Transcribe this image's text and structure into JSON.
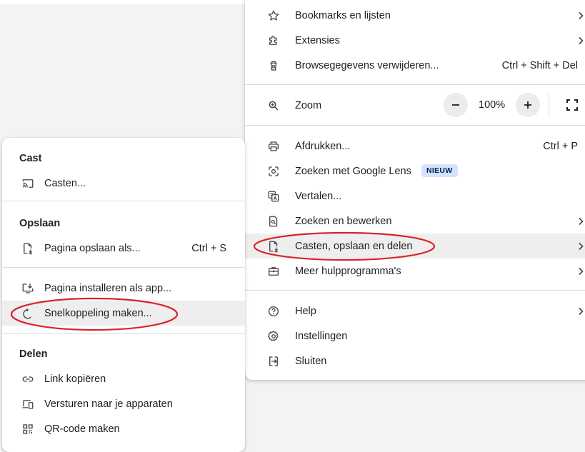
{
  "main_menu": {
    "bookmarks": {
      "label": "Bookmarks en lijsten",
      "icon": "star-icon"
    },
    "extensions": {
      "label": "Extensies",
      "icon": "puzzle-icon"
    },
    "clear_data": {
      "label": "Browsegegevens verwijderen...",
      "shortcut": "Ctrl + Shift + Del",
      "icon": "trash-icon"
    },
    "zoom": {
      "label": "Zoom",
      "value": "100%",
      "minus": "−",
      "plus": "+",
      "icon": "zoom-icon"
    },
    "print": {
      "label": "Afdrukken...",
      "shortcut": "Ctrl + P",
      "icon": "printer-icon"
    },
    "lens": {
      "label": "Zoeken met Google Lens",
      "badge": "NIEUW",
      "icon": "google-lens-icon"
    },
    "translate": {
      "label": "Vertalen...",
      "icon": "translate-icon"
    },
    "find_edit": {
      "label": "Zoeken en bewerken",
      "icon": "find-page-icon"
    },
    "cast_save_share": {
      "label": "Casten, opslaan en delen",
      "icon": "file-download-icon"
    },
    "more_tools": {
      "label": "Meer hulpprogramma's",
      "icon": "toolbox-icon"
    },
    "help": {
      "label": "Help",
      "icon": "help-icon"
    },
    "settings": {
      "label": "Instellingen",
      "icon": "gear-icon"
    },
    "exit": {
      "label": "Sluiten",
      "icon": "exit-icon"
    }
  },
  "sub_menu": {
    "cast_heading": "Cast",
    "cast": {
      "label": "Casten...",
      "icon": "cast-icon"
    },
    "save_heading": "Opslaan",
    "save_page": {
      "label": "Pagina opslaan als...",
      "shortcut": "Ctrl + S",
      "icon": "save-page-icon"
    },
    "install_app": {
      "label": "Pagina installeren als app...",
      "icon": "install-app-icon"
    },
    "shortcut": {
      "label": "Snelkoppeling maken...",
      "icon": "shortcut-icon"
    },
    "share_heading": "Delen",
    "copy_link": {
      "label": "Link kopiëren",
      "icon": "link-icon"
    },
    "send_devices": {
      "label": "Versturen naar je apparaten",
      "icon": "devices-icon"
    },
    "qr_code": {
      "label": "QR-code maken",
      "icon": "qr-code-icon"
    }
  },
  "annotation_color": "#d9242b"
}
